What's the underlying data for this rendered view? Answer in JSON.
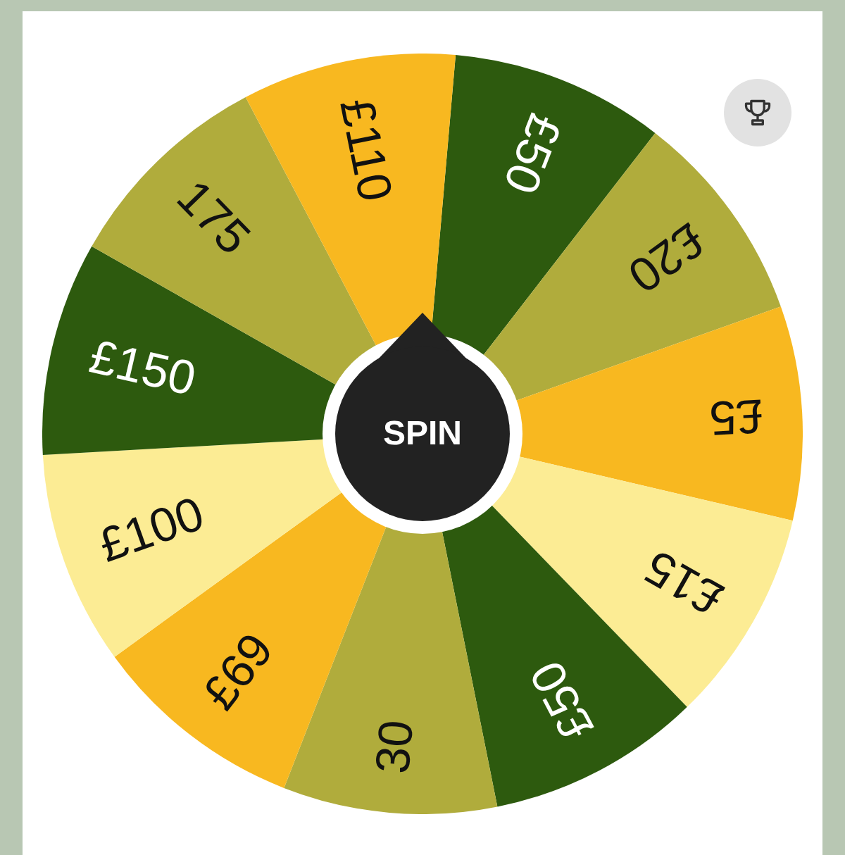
{
  "trophy_button": {
    "kind": "icon"
  },
  "wheel": {
    "segments": [
      {
        "label": "£50",
        "color": "#2d5a0e"
      },
      {
        "label": "£20",
        "color": "#b0ac3c"
      },
      {
        "label": "£5",
        "color": "#f8b820"
      },
      {
        "label": "£15",
        "color": "#fcec94"
      },
      {
        "label": "£50",
        "color": "#2d5a0e"
      },
      {
        "label": "30",
        "color": "#b0ac3c"
      },
      {
        "label": "£69",
        "color": "#f8b820"
      },
      {
        "label": "£100",
        "color": "#fcec94"
      },
      {
        "label": "£150",
        "color": "#2d5a0e"
      },
      {
        "label": "175",
        "color": "#b0ac3c"
      },
      {
        "label": "£110",
        "color": "#f8b820"
      }
    ]
  },
  "spin_button": {
    "label": "SPIN"
  }
}
